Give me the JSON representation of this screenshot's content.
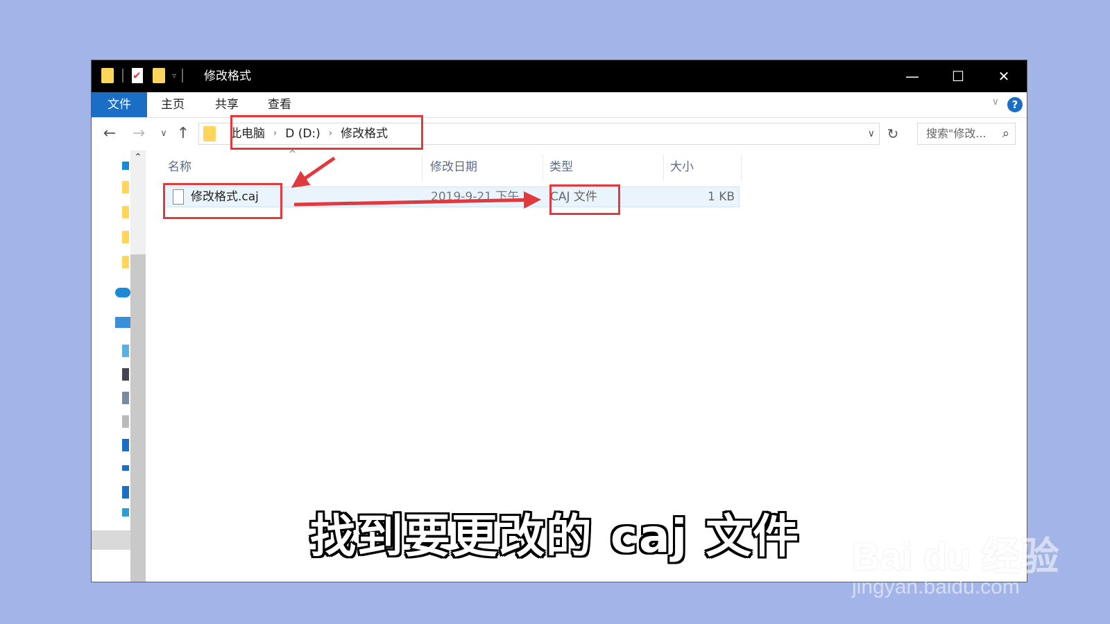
{
  "window": {
    "title": "修改格式",
    "minimize_glyph": "—",
    "maximize_glyph": "☐",
    "close_glyph": "✕"
  },
  "ribbon": {
    "tabs": [
      "文件",
      "主页",
      "共享",
      "查看"
    ],
    "help_glyph": "?",
    "collapse_glyph": "∨"
  },
  "navigation": {
    "back_glyph": "←",
    "forward_glyph": "→",
    "recent_glyph": "∨",
    "up_glyph": "↑",
    "breadcrumbs": [
      "此电脑",
      "D (D:)",
      "修改格式"
    ],
    "separator_glyph": "›",
    "dropdown_glyph": "∨",
    "refresh_glyph": "↻",
    "search_placeholder": "搜索\"修改...",
    "search_glyph": "⌕"
  },
  "columns": {
    "name": "名称",
    "date": "修改日期",
    "type": "类型",
    "size": "大小"
  },
  "files": [
    {
      "name": "修改格式.caj",
      "date": "2019-9-21 下午",
      "type": "CAJ 文件",
      "size": "1 KB"
    }
  ],
  "caption": "找到要更改的 caj 文件",
  "watermark": {
    "brand": "Bai du 经验",
    "url": "jingyan.baidu.com"
  },
  "colors": {
    "background": "#a3b4e8",
    "accent": "#1a6fc4",
    "highlight": "#e0393e"
  }
}
